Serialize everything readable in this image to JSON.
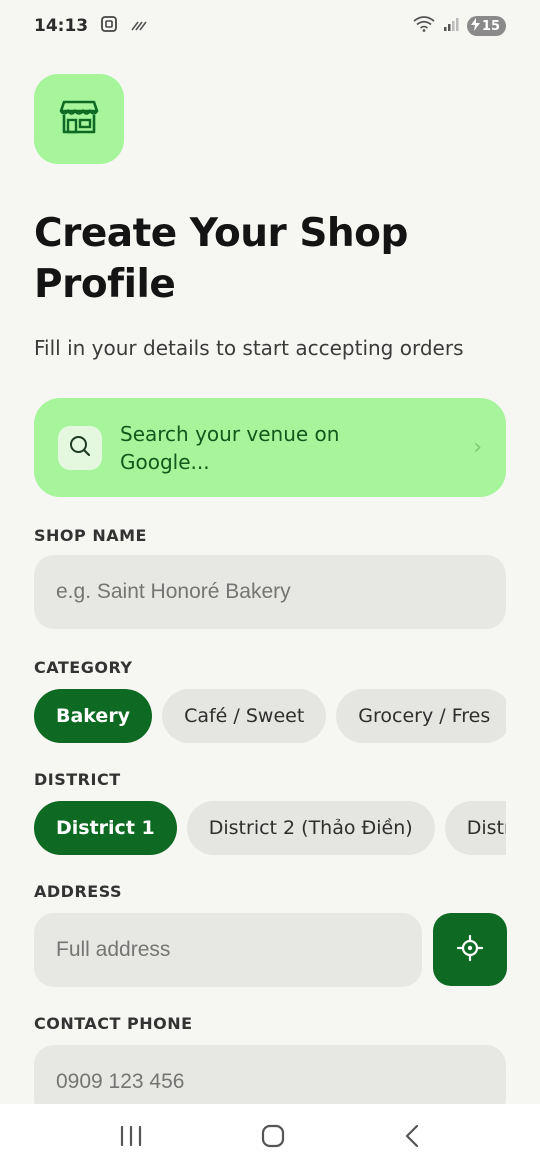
{
  "status": {
    "time": "14:13",
    "battery": "15"
  },
  "header": {
    "title": "Create Your Shop Profile",
    "subtitle": "Fill in your details to start accepting orders",
    "icon": "storefront-icon"
  },
  "search": {
    "label": "Search your venue on Google...",
    "icon": "search-icon"
  },
  "shop_name": {
    "label": "SHOP NAME",
    "placeholder": "e.g. Saint Honoré Bakery",
    "value": ""
  },
  "category": {
    "label": "CATEGORY",
    "options": [
      "Bakery",
      "Café / Sweet",
      "Grocery / Fres"
    ],
    "selected": "Bakery"
  },
  "district": {
    "label": "DISTRICT",
    "options": [
      "District 1",
      "District 2 (Thảo Điền)",
      "Distri"
    ],
    "selected": "District 1"
  },
  "address": {
    "label": "ADDRESS",
    "placeholder": "Full address",
    "value": ""
  },
  "phone": {
    "label": "CONTACT PHONE",
    "placeholder": "0909 123 456",
    "value": ""
  },
  "colors": {
    "accent_light": "#a6f59a",
    "accent_dark": "#0e6a22",
    "background": "#f6f7f3"
  }
}
